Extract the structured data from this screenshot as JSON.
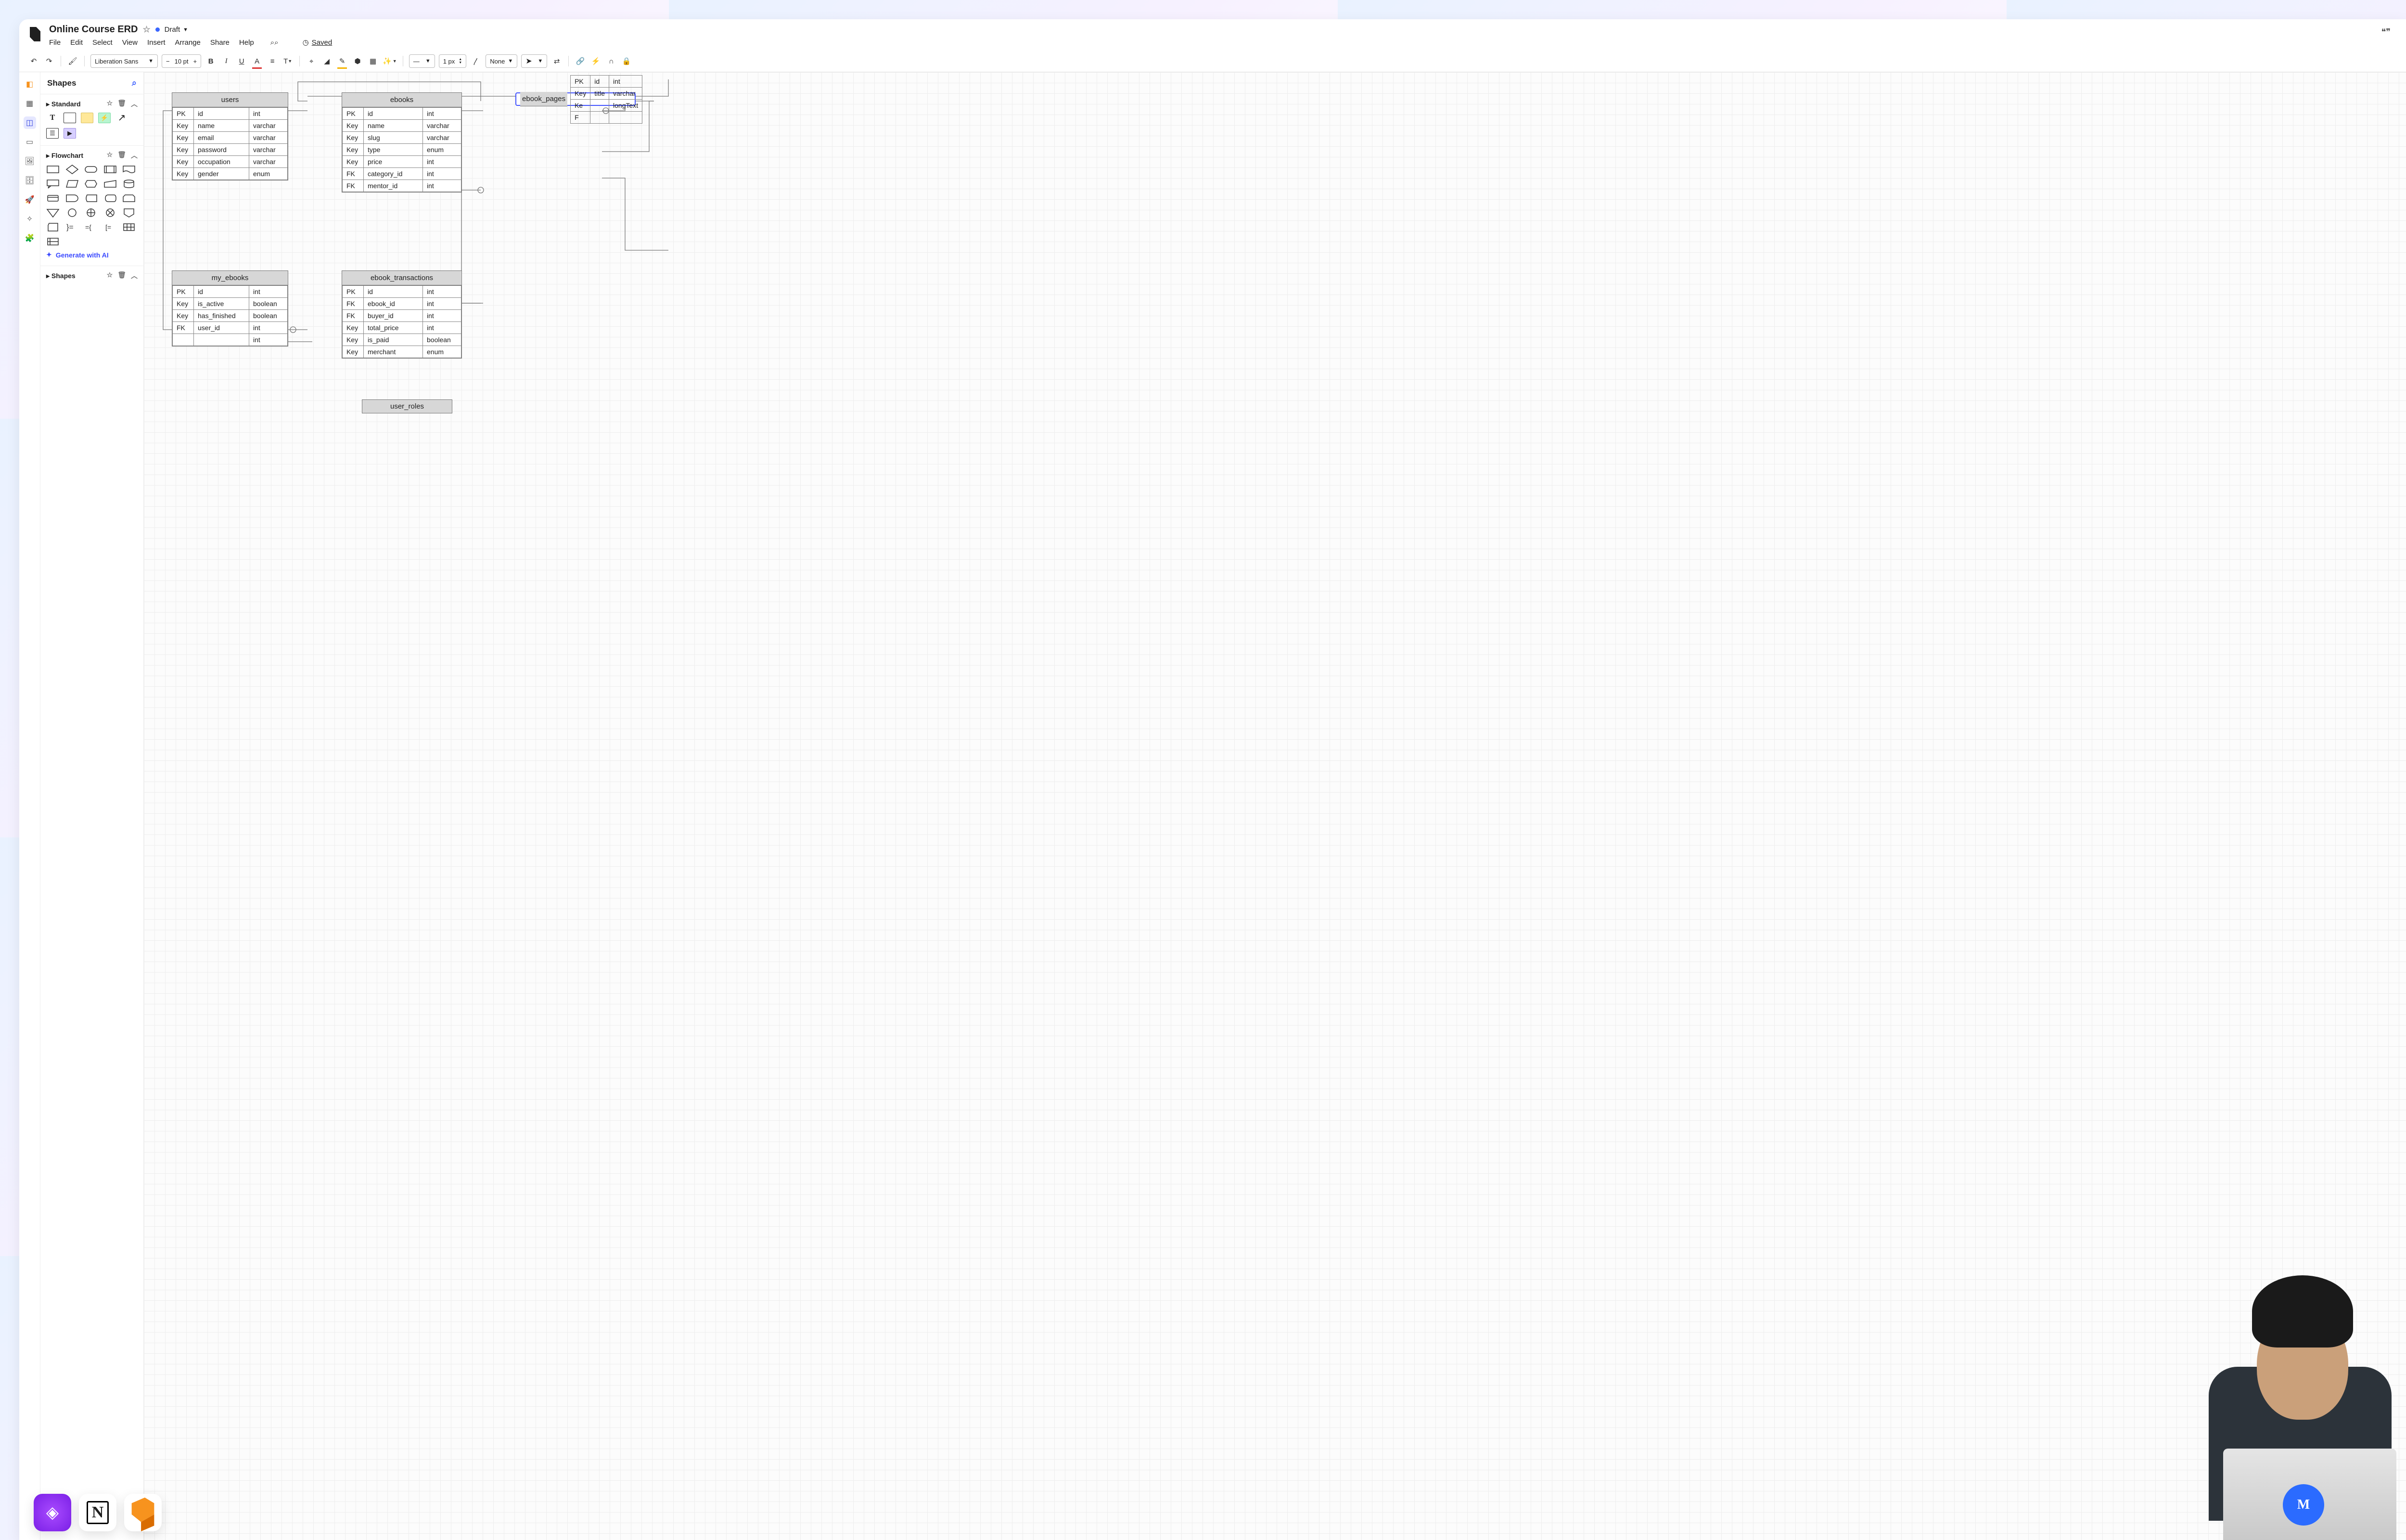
{
  "header": {
    "title": "Online Course ERD",
    "status": "Draft",
    "menus": [
      "File",
      "Edit",
      "Select",
      "View",
      "Insert",
      "Arrange",
      "Share",
      "Help"
    ],
    "saved_label": "Saved"
  },
  "toolbar": {
    "font": "Liberation Sans",
    "font_size": "10 pt",
    "line_width": "1 px",
    "endpoint": "None"
  },
  "panel": {
    "title": "Shapes",
    "sections": {
      "standard": "Standard",
      "flowchart": "Flowchart",
      "shapes": "Shapes"
    },
    "gen_ai": "Generate with AI"
  },
  "entities": {
    "users": {
      "name": "users",
      "rows": [
        [
          "PK",
          "id",
          "int"
        ],
        [
          "Key",
          "name",
          "varchar"
        ],
        [
          "Key",
          "email",
          "varchar"
        ],
        [
          "Key",
          "password",
          "varchar"
        ],
        [
          "Key",
          "occupation",
          "varchar"
        ],
        [
          "Key",
          "gender",
          "enum"
        ]
      ]
    },
    "ebooks": {
      "name": "ebooks",
      "rows": [
        [
          "PK",
          "id",
          "int"
        ],
        [
          "Key",
          "name",
          "varchar"
        ],
        [
          "Key",
          "slug",
          "varchar"
        ],
        [
          "Key",
          "type",
          "enum"
        ],
        [
          "Key",
          "price",
          "int"
        ],
        [
          "FK",
          "category_id",
          "int"
        ],
        [
          "FK",
          "mentor_id",
          "int"
        ]
      ]
    },
    "ebook_pages": {
      "name": "ebook_pages",
      "rows": [
        [
          "PK",
          "id",
          "int"
        ],
        [
          "Key",
          "title",
          "varchar"
        ],
        [
          "Ke",
          "",
          "longText"
        ],
        [
          "F",
          "",
          ""
        ]
      ]
    },
    "my_ebooks": {
      "name": "my_ebooks",
      "rows": [
        [
          "PK",
          "id",
          "int"
        ],
        [
          "Key",
          "is_active",
          "boolean"
        ],
        [
          "Key",
          "has_finished",
          "boolean"
        ],
        [
          "FK",
          "user_id",
          "int"
        ],
        [
          "",
          "",
          "int"
        ]
      ]
    },
    "ebook_transactions": {
      "name": "ebook_transactions",
      "rows": [
        [
          "PK",
          "id",
          "int"
        ],
        [
          "FK",
          "ebook_id",
          "int"
        ],
        [
          "FK",
          "buyer_id",
          "int"
        ],
        [
          "Key",
          "total_price",
          "int"
        ],
        [
          "Key",
          "is_paid",
          "boolean"
        ],
        [
          "Key",
          "merchant",
          "enum"
        ]
      ]
    },
    "user_roles": {
      "name": "user_roles"
    }
  }
}
